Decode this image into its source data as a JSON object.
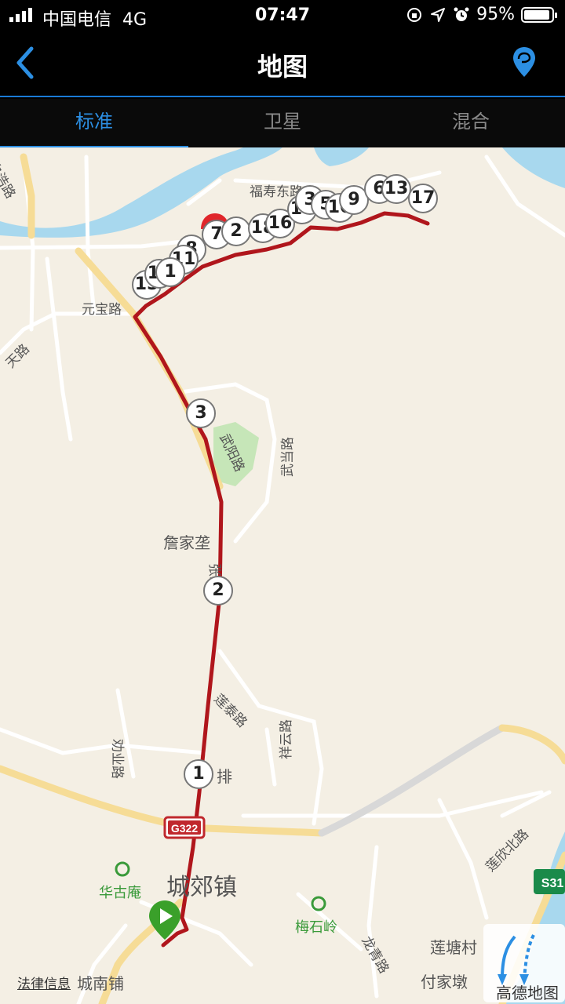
{
  "status_bar": {
    "carrier": "中国电信",
    "network": "4G",
    "time": "07:47",
    "battery": "95%",
    "battery_level": 0.95,
    "icons": [
      "orientation-lock-icon",
      "location-arrow-icon",
      "alarm-icon"
    ]
  },
  "nav": {
    "title": "地图",
    "back_icon": "chevron-left-icon",
    "right_icon": "location-pin-icon"
  },
  "tabs": [
    {
      "label": "标准",
      "active": true
    },
    {
      "label": "卫星",
      "active": false
    },
    {
      "label": "混合",
      "active": false
    }
  ],
  "map": {
    "road_labels": [
      "白浩路",
      "福寿东路",
      "元宝路",
      "天路",
      "武阳路",
      "武当路",
      "张三道",
      "莲泰路",
      "劝业路",
      "祥云路",
      "莲欣北路",
      "龙青路",
      "G322",
      "S31"
    ],
    "place_labels": [
      "詹家垄",
      "城郊镇",
      "城南铺",
      "莲塘村",
      "付家墩",
      "排"
    ],
    "pois": [
      "华古庵",
      "梅石岭"
    ],
    "route_markers": [
      "1",
      "2",
      "3",
      "7",
      "8",
      "11",
      "15",
      "19",
      "1",
      "2",
      "18",
      "16",
      "14",
      "3",
      "5",
      "10",
      "9",
      "6",
      "13",
      "17"
    ],
    "legal_link": "法律信息",
    "map_provider": "高德地图",
    "route_color": "#b0161c",
    "start_color": "#3aa02a",
    "end_color": "#e0262b"
  }
}
